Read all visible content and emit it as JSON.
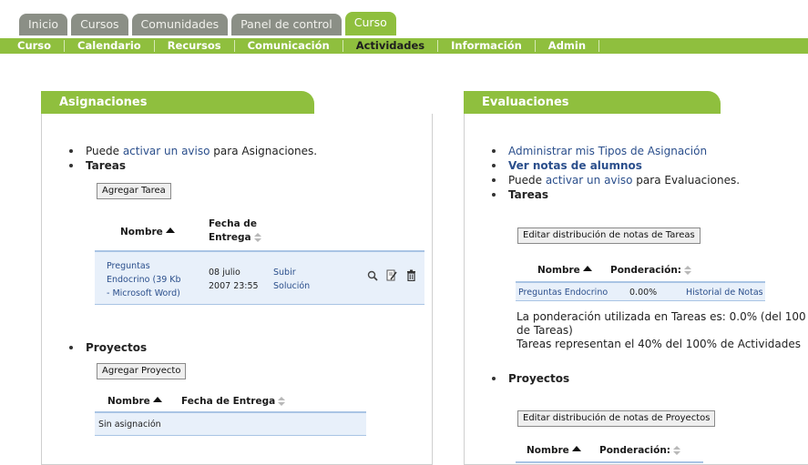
{
  "top_tabs": [
    "Inicio",
    "Cursos",
    "Comunidades",
    "Panel de control",
    "Curso"
  ],
  "subnav": [
    "Curso",
    "Calendario",
    "Recursos",
    "Comunicación",
    "Actividades",
    "Información",
    "Admin"
  ],
  "asignaciones": {
    "title": "Asignaciones",
    "aviso": {
      "prefix": "Puede ",
      "link1": "activar",
      "link2": "un aviso",
      "suffix": " para Asignaciones."
    },
    "tareas": {
      "label": "Tareas",
      "add_button": "Agregar Tarea",
      "col_nombre": "Nombre",
      "col_fecha_1": "Fecha de",
      "col_fecha_2": "Entrega",
      "row": {
        "name_1": "Preguntas",
        "name_2": "Endocrino (39 Kb",
        "name_3": "- Microsoft Word)",
        "date_1": "08 julio",
        "date_2": "2007 23:55",
        "action_1": "Subir",
        "action_2": "Solución"
      }
    },
    "proyectos": {
      "label": "Proyectos",
      "add_button": "Agregar Proyecto",
      "col_nombre": "Nombre",
      "col_fecha": "Fecha de Entrega",
      "empty": "Sin asignación"
    }
  },
  "evaluaciones": {
    "title": "Evaluaciones",
    "link_tipos": "Administrar mis Tipos de Asignación",
    "link_notas": "Ver notas de alumnos",
    "aviso": {
      "prefix": "Puede ",
      "link1": "activar",
      "link2": "un aviso",
      "suffix": " para Evaluaciones."
    },
    "tareas": {
      "label": "Tareas",
      "edit_button": "Editar distribución de notas de Tareas",
      "col_nombre": "Nombre",
      "col_pond": "Ponderación:",
      "row": {
        "name": "Preguntas Endocrino",
        "pond": "0.00%",
        "hist": "Historial de Notas"
      },
      "note_1": "La ponderación utilizada en Tareas es: 0.0% (del 100",
      "note_2": "de Tareas)",
      "note_3": "Tareas representan el 40% del 100% de Actividades"
    },
    "proyectos": {
      "label": "Proyectos",
      "edit_button": "Editar distribución de notas de Proyectos",
      "col_nombre": "Nombre",
      "col_pond": "Ponderación:"
    }
  }
}
